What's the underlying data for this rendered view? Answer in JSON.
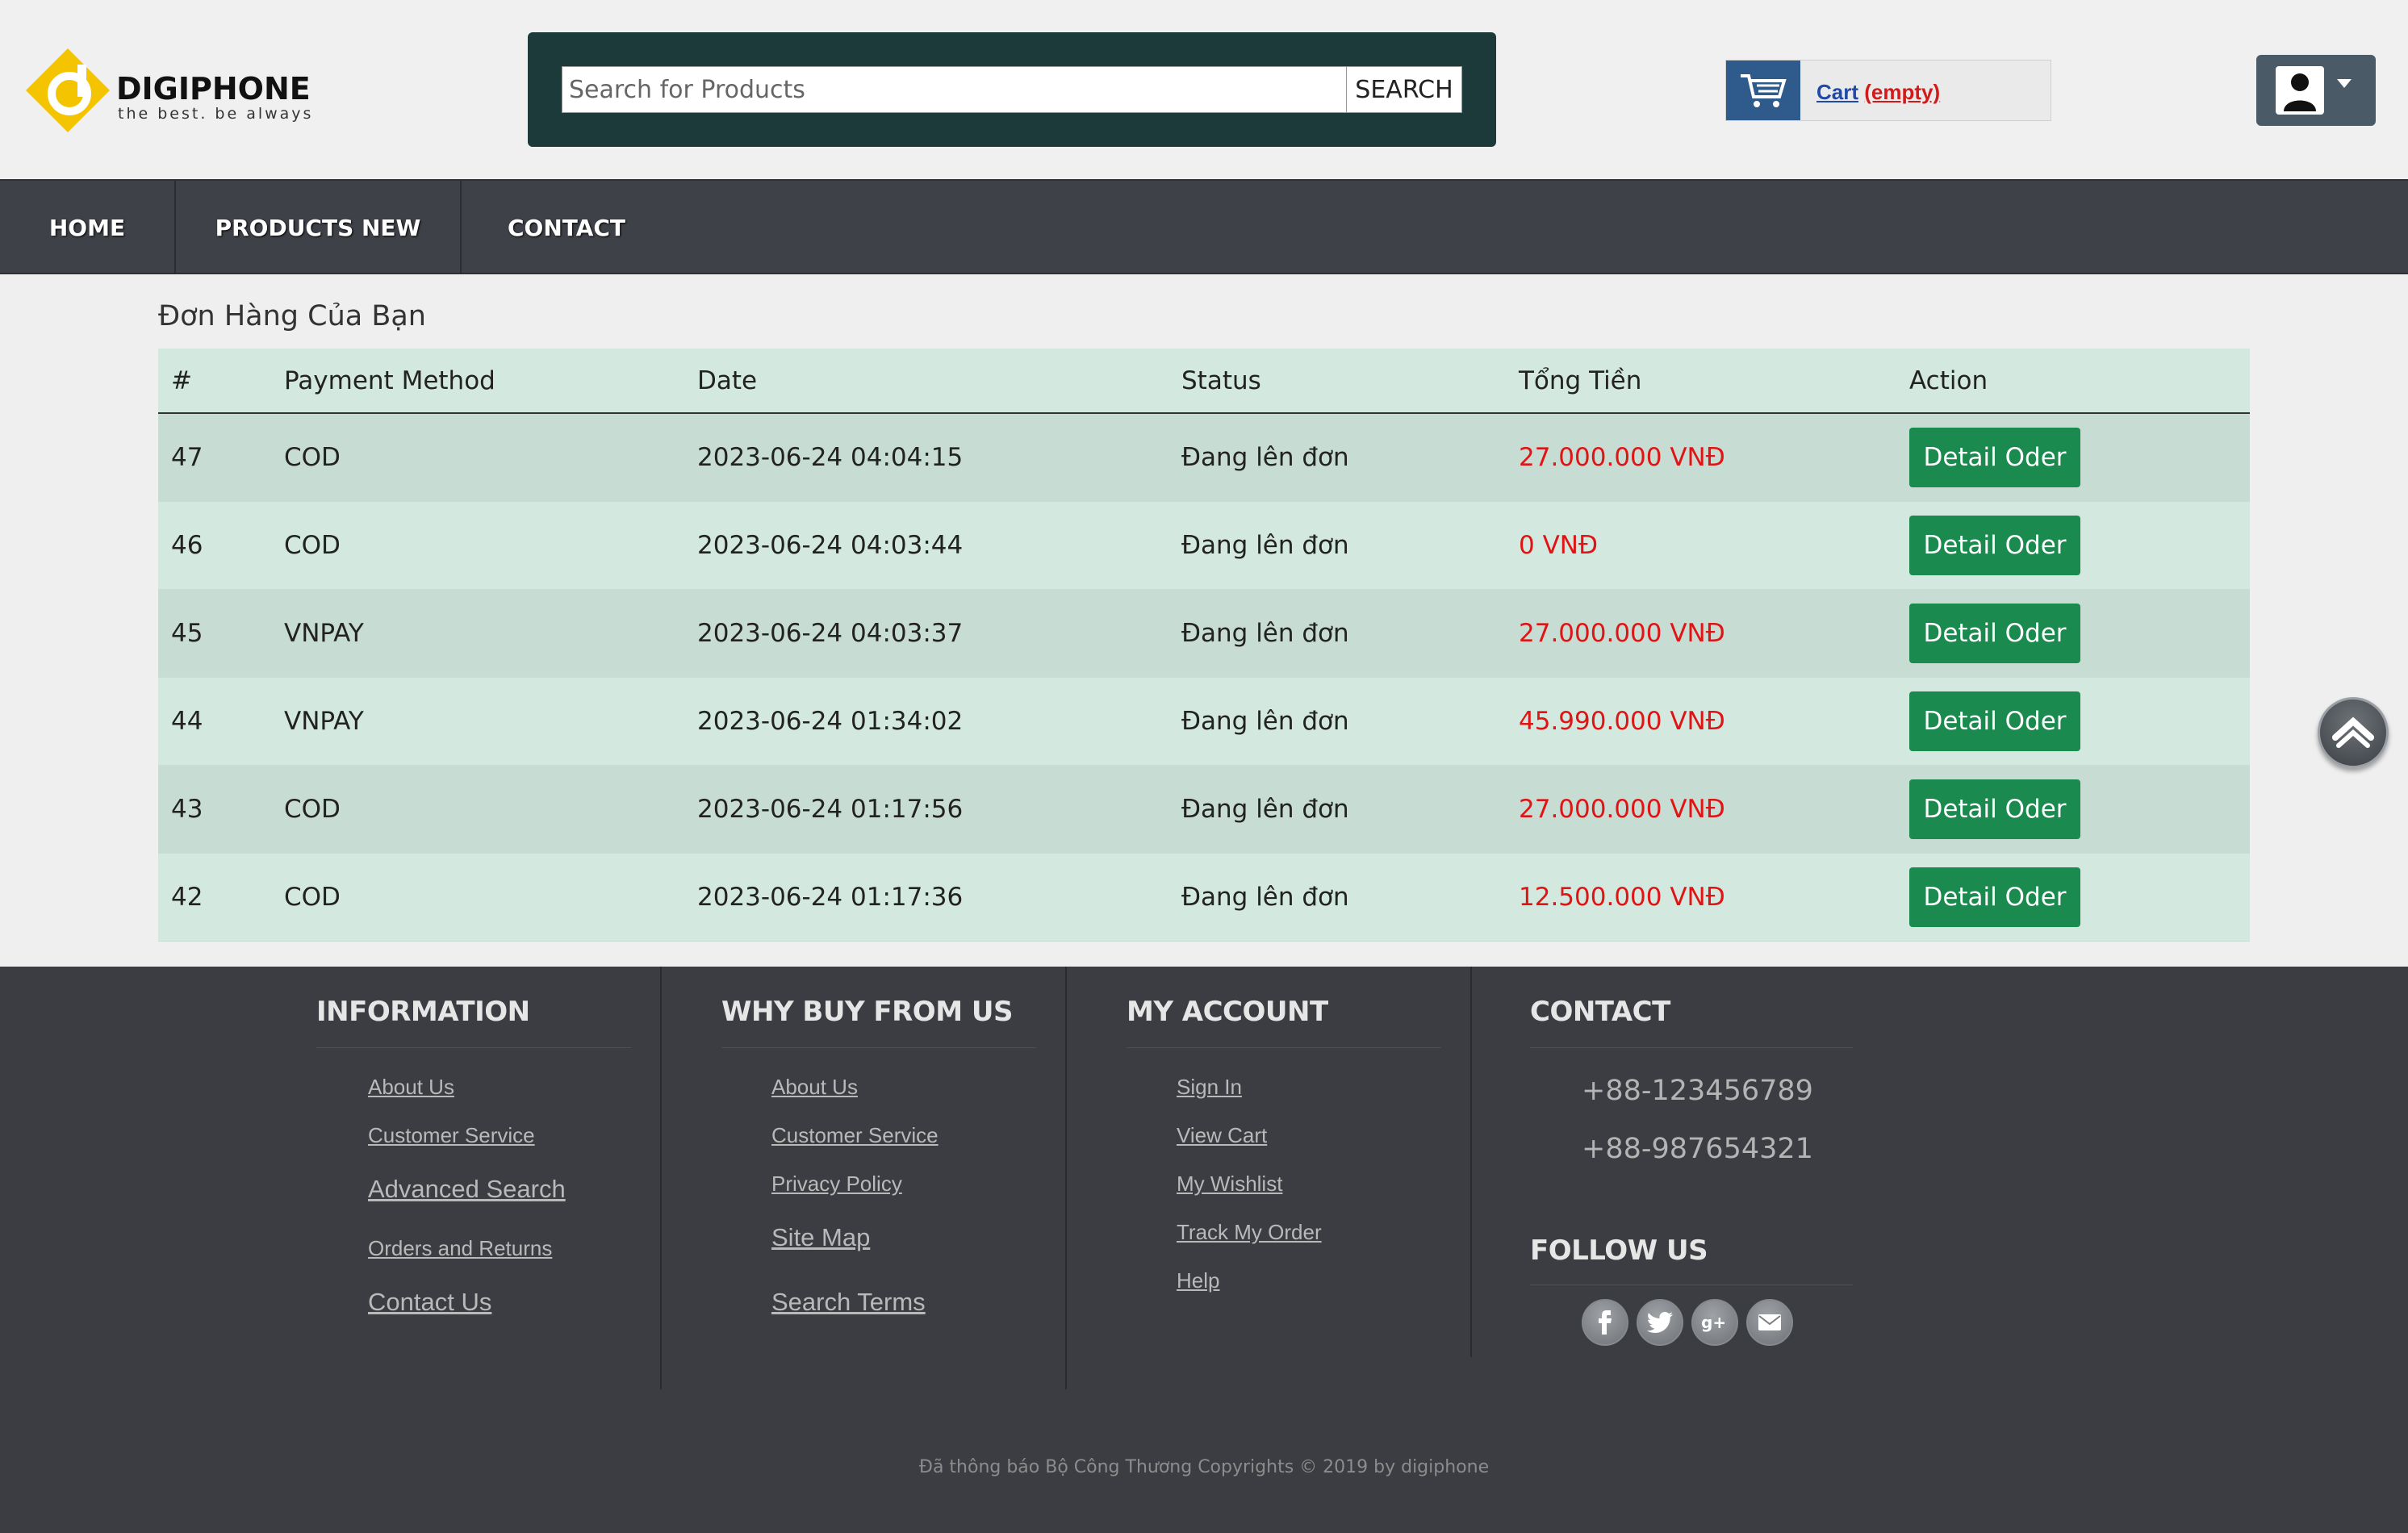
{
  "header": {
    "logo": {
      "name": "DIGIPHONE",
      "tagline": "the best. be always"
    },
    "search": {
      "placeholder": "Search for Products",
      "button_label": "SEARCH"
    },
    "cart": {
      "label": "Cart",
      "status": "(empty)"
    },
    "account": {
      "icon": "user-icon"
    }
  },
  "nav": {
    "items": [
      {
        "label": "HOME"
      },
      {
        "label": "PRODUCTS NEW"
      },
      {
        "label": "CONTACT"
      }
    ]
  },
  "main": {
    "title": "Đơn Hàng Của Bạn",
    "columns": [
      "#",
      "Payment Method",
      "Date",
      "Status",
      "Tổng Tiền",
      "Action"
    ],
    "rows": [
      {
        "id": "47",
        "payment": "COD",
        "date": "2023-06-24 04:04:15",
        "status": "Đang lên đơn",
        "total": "27.000.000 VNĐ",
        "action": "Detail Oder"
      },
      {
        "id": "46",
        "payment": "COD",
        "date": "2023-06-24 04:03:44",
        "status": "Đang lên đơn",
        "total": "0 VNĐ",
        "action": "Detail Oder"
      },
      {
        "id": "45",
        "payment": "VNPAY",
        "date": "2023-06-24 04:03:37",
        "status": "Đang lên đơn",
        "total": "27.000.000 VNĐ",
        "action": "Detail Oder"
      },
      {
        "id": "44",
        "payment": "VNPAY",
        "date": "2023-06-24 01:34:02",
        "status": "Đang lên đơn",
        "total": "45.990.000 VNĐ",
        "action": "Detail Oder"
      },
      {
        "id": "43",
        "payment": "COD",
        "date": "2023-06-24 01:17:56",
        "status": "Đang lên đơn",
        "total": "27.000.000 VNĐ",
        "action": "Detail Oder"
      },
      {
        "id": "42",
        "payment": "COD",
        "date": "2023-06-24 01:17:36",
        "status": "Đang lên đơn",
        "total": "12.500.000 VNĐ",
        "action": "Detail Oder"
      }
    ]
  },
  "footer": {
    "information": {
      "heading": "INFORMATION",
      "links": [
        "About Us",
        "Customer Service",
        "Advanced Search",
        "Orders and Returns",
        "Contact Us"
      ]
    },
    "why_buy": {
      "heading": "WHY BUY FROM US",
      "links": [
        "About Us",
        "Customer Service",
        "Privacy Policy",
        "Site Map",
        "Search Terms"
      ]
    },
    "my_account": {
      "heading": "MY ACCOUNT",
      "links": [
        "Sign In",
        "View Cart",
        "My Wishlist",
        "Track My Order",
        "Help"
      ]
    },
    "contact": {
      "heading": "CONTACT",
      "phones": [
        "+88-123456789",
        "+88-987654321"
      ]
    },
    "follow": {
      "heading": "FOLLOW US",
      "icons": [
        "facebook-icon",
        "twitter-icon",
        "google-plus-icon",
        "email-icon"
      ]
    },
    "copyright": "Đã thông báo Bộ Công Thương Copyrights © 2019 by digiphone"
  },
  "colors": {
    "accent_green": "#1b8a4e",
    "price_red": "#e01414",
    "nav_bg": "#3f4148",
    "footer_bg": "#3c3d42",
    "table_bg": "#d3e9df"
  }
}
